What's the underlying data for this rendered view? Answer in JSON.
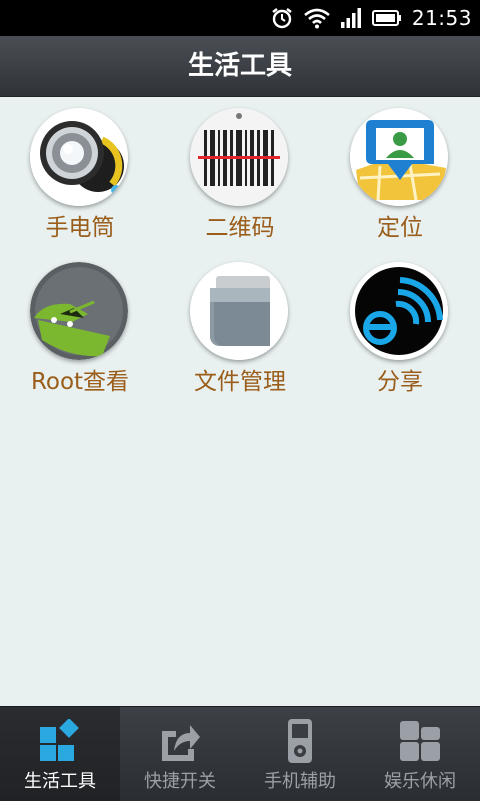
{
  "statusbar": {
    "time": "21:53",
    "icons": [
      "alarm-icon",
      "wifi-icon",
      "signal-icon",
      "battery-icon"
    ]
  },
  "header": {
    "title": "生活工具"
  },
  "tools": [
    {
      "label": "手电筒",
      "icon": "flashlight-icon"
    },
    {
      "label": "二维码",
      "icon": "barcode-icon"
    },
    {
      "label": "定位",
      "icon": "location-icon"
    },
    {
      "label": "Root查看",
      "icon": "android-root-icon"
    },
    {
      "label": "文件管理",
      "icon": "file-manager-icon"
    },
    {
      "label": "分享",
      "icon": "share-icon"
    }
  ],
  "tabs": [
    {
      "label": "生活工具",
      "icon": "tools-grid-icon",
      "active": true
    },
    {
      "label": "快捷开关",
      "icon": "share-arrow-icon",
      "active": false
    },
    {
      "label": "手机辅助",
      "icon": "phone-icon",
      "active": false
    },
    {
      "label": "娱乐休闲",
      "icon": "apps-icon",
      "active": false
    }
  ],
  "colors": {
    "label_text": "#9a5d1a",
    "background": "#e8f0f0",
    "accent_blue": "#27a9e1"
  }
}
